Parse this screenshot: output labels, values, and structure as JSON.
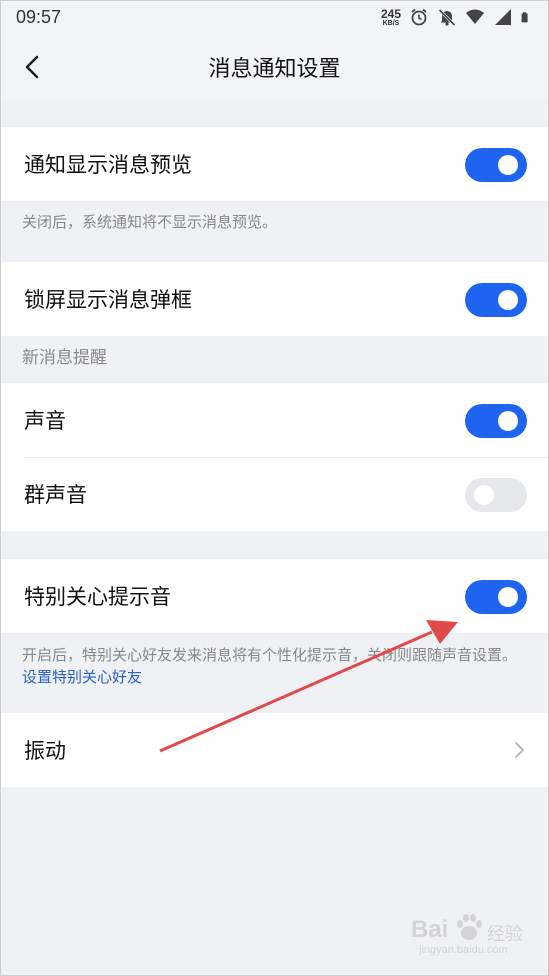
{
  "status_bar": {
    "time": "09:57",
    "net_speed": "245",
    "net_unit": "KB/S"
  },
  "header": {
    "title": "消息通知设置"
  },
  "settings": {
    "preview": {
      "label": "通知显示消息预览",
      "enabled": true
    },
    "preview_note": "关闭后，系统通知将不显示消息预览。",
    "lockscreen": {
      "label": "锁屏显示消息弹框",
      "enabled": true
    },
    "section_new_message": "新消息提醒",
    "sound": {
      "label": "声音",
      "enabled": true
    },
    "group_sound": {
      "label": "群声音",
      "enabled": false
    },
    "special_care": {
      "label": "特别关心提示音",
      "enabled": true
    },
    "special_care_note": "开启后，特别关心好友发来消息将有个性化提示音，关闭则跟随声音设置。",
    "special_care_link": "设置特别关心好友",
    "vibration": {
      "label": "振动"
    }
  },
  "colors": {
    "accent": "#1f64f0",
    "toggle_off": "#e6e8ee",
    "annotation_arrow": "#e24a4a",
    "link": "#2462c9"
  },
  "watermark": {
    "brand": "Bai",
    "brand_sub": "经验",
    "url": "jingyan.baidu.com"
  }
}
